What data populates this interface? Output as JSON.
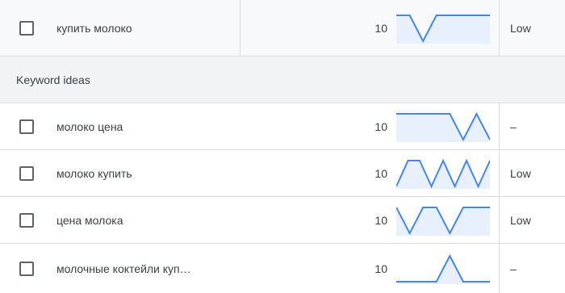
{
  "colors": {
    "spark_line": "#4285f4",
    "spark_fill": "#e8f0fe",
    "section_bg": "#f1f3f4",
    "divider": "#dadce0"
  },
  "top_row": {
    "keyword": "купить молоко",
    "volume": "10",
    "competition": "Low",
    "trend": [
      1,
      1,
      0,
      1,
      1,
      1,
      1,
      1
    ]
  },
  "section": {
    "title": "Keyword ideas"
  },
  "rows": [
    {
      "keyword": "молоко цена",
      "volume": "10",
      "competition": "–",
      "trend": [
        1,
        1,
        1,
        1,
        1,
        0,
        1,
        0
      ]
    },
    {
      "keyword": "молоко купить",
      "volume": "10",
      "competition": "Low",
      "trend": [
        0,
        1,
        1,
        0,
        1,
        0,
        1,
        0,
        1
      ]
    },
    {
      "keyword": "цена молока",
      "volume": "10",
      "competition": "Low",
      "trend": [
        1,
        0,
        1,
        1,
        0,
        1,
        1,
        1
      ]
    },
    {
      "keyword": "молочные коктейли куп…",
      "volume": "10",
      "competition": "–",
      "trend": [
        0,
        0,
        0,
        0,
        1,
        0,
        0,
        0
      ]
    }
  ]
}
